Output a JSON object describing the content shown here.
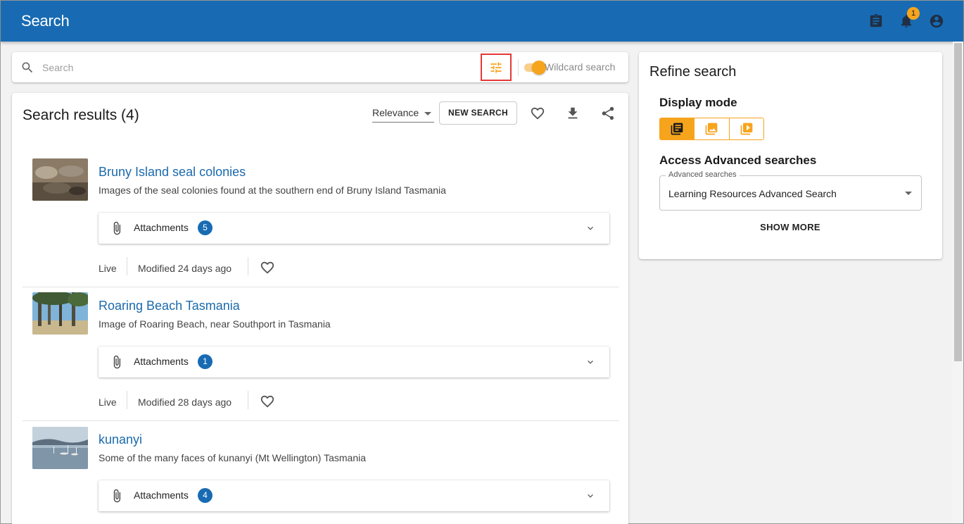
{
  "header": {
    "title": "Search",
    "notification_count": "1"
  },
  "search": {
    "placeholder": "Search",
    "wildcard_label": "Wildcard search"
  },
  "results": {
    "title": "Search results (4)",
    "sort_value": "Relevance",
    "new_search_label": "NEW SEARCH",
    "items": [
      {
        "title": "Bruny Island seal colonies",
        "description": "Images of the seal colonies found at the southern end of Bruny Island Tasmania",
        "attachments_label": "Attachments",
        "attachments_count": "5",
        "status": "Live",
        "modified": "Modified 24 days ago"
      },
      {
        "title": "Roaring Beach Tasmania",
        "description": "Image of Roaring Beach, near Southport in Tasmania",
        "attachments_label": "Attachments",
        "attachments_count": "1",
        "status": "Live",
        "modified": "Modified 28 days ago"
      },
      {
        "title": "kunanyi",
        "description": "Some of the many faces of kunanyi (Mt Wellington) Tasmania",
        "attachments_label": "Attachments",
        "attachments_count": "4"
      }
    ]
  },
  "refine": {
    "title": "Refine search",
    "display_mode_title": "Display mode",
    "advanced_title": "Access Advanced searches",
    "advanced_legend": "Advanced searches",
    "advanced_value": "Learning Resources Advanced Search",
    "show_more_label": "SHOW MORE"
  },
  "colors": {
    "primary": "#186bb3",
    "accent": "#f7a41d",
    "highlight_box": "#e53935"
  }
}
